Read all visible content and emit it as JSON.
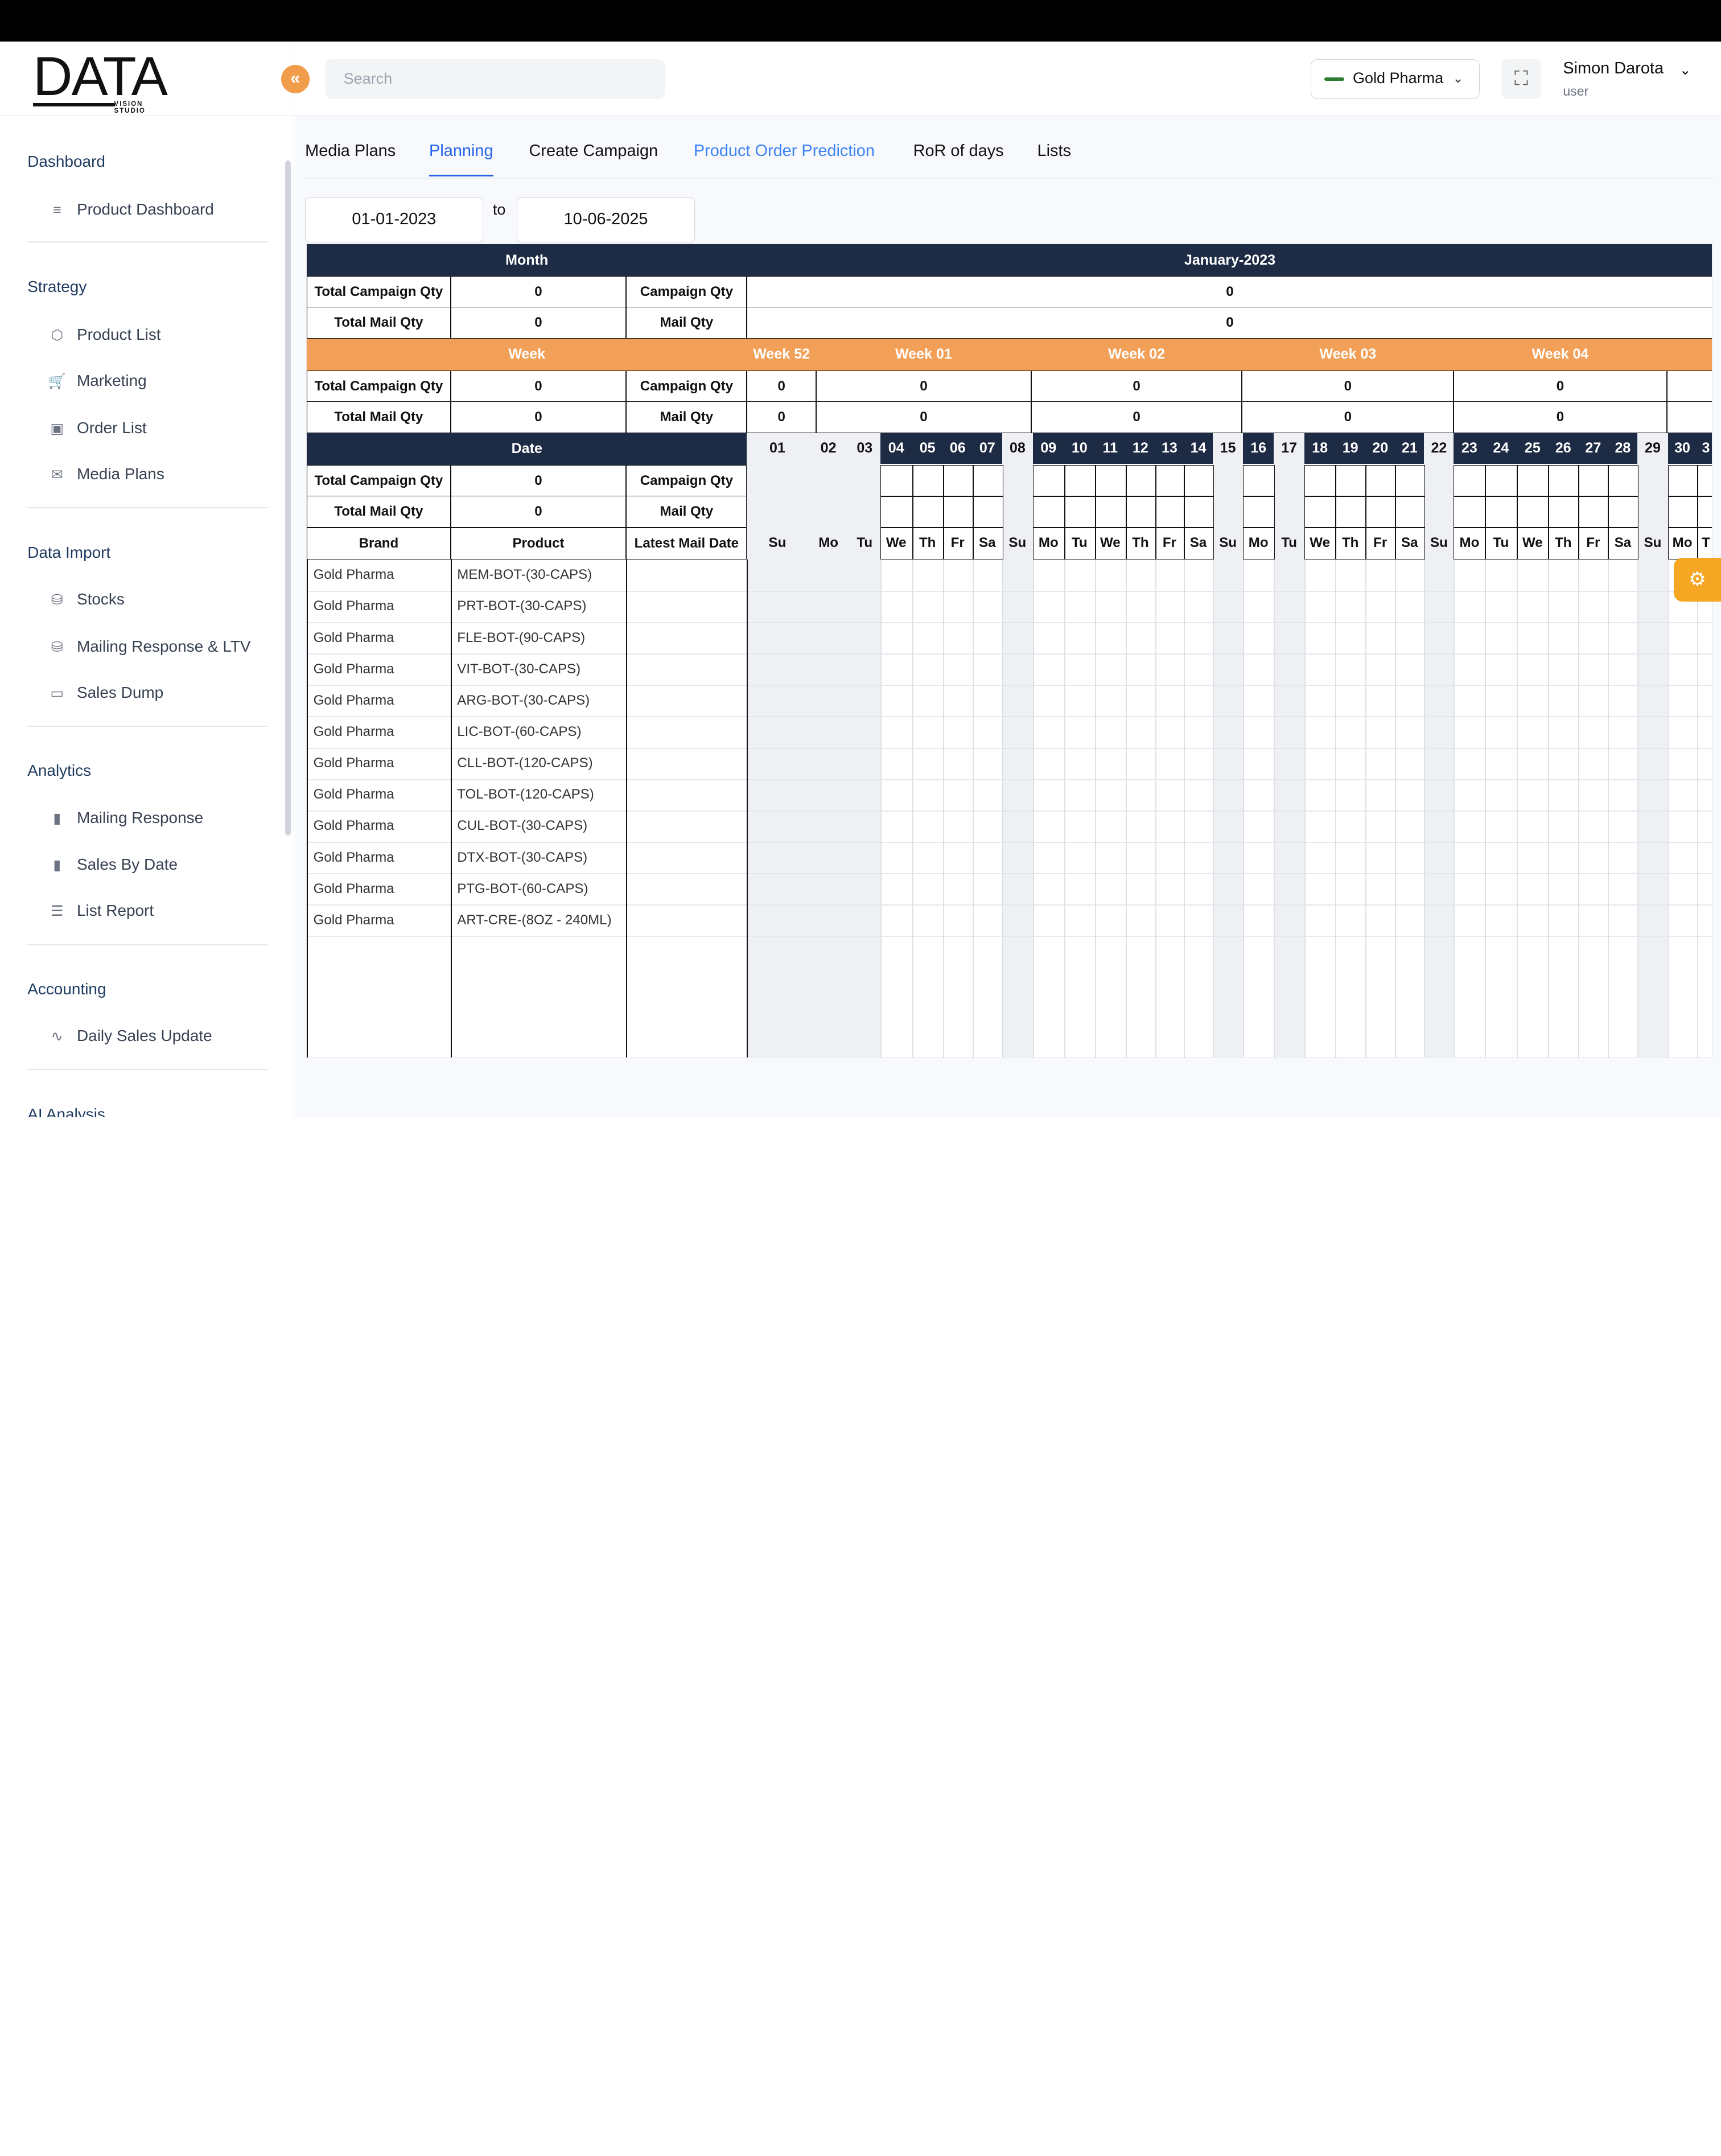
{
  "logo": {
    "text": "DATA",
    "sub": "VISION STUDIO"
  },
  "header": {
    "search_placeholder": "Search",
    "company": "Gold Pharma",
    "user_name": "Simon Darota",
    "user_role": "user"
  },
  "sidebar": {
    "sections": [
      {
        "title": "Dashboard",
        "items": [
          {
            "label": "Product Dashboard",
            "icon": "menu-icon"
          }
        ]
      },
      {
        "title": "Strategy",
        "items": [
          {
            "label": "Product List",
            "icon": "box-icon"
          },
          {
            "label": "Marketing",
            "icon": "cart-icon"
          },
          {
            "label": "Order List",
            "icon": "briefcase-icon"
          },
          {
            "label": "Media Plans",
            "icon": "mail-icon"
          }
        ]
      },
      {
        "title": "Data Import",
        "items": [
          {
            "label": "Stocks",
            "icon": "database-icon"
          },
          {
            "label": "Mailing Response & LTV",
            "icon": "database-icon"
          },
          {
            "label": "Sales Dump",
            "icon": "hard-drive-icon"
          }
        ]
      },
      {
        "title": "Analytics",
        "items": [
          {
            "label": "Mailing Response",
            "icon": "bar-chart-icon"
          },
          {
            "label": "Sales By Date",
            "icon": "bar-chart-icon"
          },
          {
            "label": "List Report",
            "icon": "list-icon"
          }
        ]
      },
      {
        "title": "Accounting",
        "items": [
          {
            "label": "Daily Sales Update",
            "icon": "activity-icon"
          }
        ]
      },
      {
        "title": "AI Analysis",
        "items": []
      }
    ]
  },
  "tabs": [
    "Media Plans",
    "Planning",
    "Create Campaign",
    "Product Order Prediction",
    "RoR of days",
    "Lists"
  ],
  "active_tab": "Planning",
  "date_range": {
    "from": "01-01-2023",
    "to_label": "to",
    "to": "10-06-2025"
  },
  "grid": {
    "month_label": "Month",
    "month_value": "January-2023",
    "week_label": "Week",
    "date_label": "Date",
    "total_campaign_qty": "Total Campaign Qty",
    "total_mail_qty": "Total Mail Qty",
    "campaign_qty": "Campaign Qty",
    "mail_qty": "Mail Qty",
    "zero": "0",
    "col_brand": "Brand",
    "col_product": "Product",
    "col_latest_mail_date": "Latest Mail Date",
    "weeks": [
      "Week 52",
      "Week 01",
      "Week 02",
      "Week 03",
      "Week 04"
    ],
    "days": [
      {
        "n": "01",
        "d": "Su"
      },
      {
        "n": "02",
        "d": "Mo"
      },
      {
        "n": "03",
        "d": "Tu"
      },
      {
        "n": "04",
        "d": "We"
      },
      {
        "n": "05",
        "d": "Th"
      },
      {
        "n": "06",
        "d": "Fr"
      },
      {
        "n": "07",
        "d": "Sa"
      },
      {
        "n": "08",
        "d": "Su"
      },
      {
        "n": "09",
        "d": "Mo"
      },
      {
        "n": "10",
        "d": "Tu"
      },
      {
        "n": "11",
        "d": "We"
      },
      {
        "n": "12",
        "d": "Th"
      },
      {
        "n": "13",
        "d": "Fr"
      },
      {
        "n": "14",
        "d": "Sa"
      },
      {
        "n": "15",
        "d": "Su"
      },
      {
        "n": "16",
        "d": "Mo"
      },
      {
        "n": "17",
        "d": "Tu"
      },
      {
        "n": "18",
        "d": "We"
      },
      {
        "n": "19",
        "d": "Th"
      },
      {
        "n": "20",
        "d": "Fr"
      },
      {
        "n": "21",
        "d": "Sa"
      },
      {
        "n": "22",
        "d": "Su"
      },
      {
        "n": "23",
        "d": "Mo"
      },
      {
        "n": "24",
        "d": "Tu"
      },
      {
        "n": "25",
        "d": "We"
      },
      {
        "n": "26",
        "d": "Th"
      },
      {
        "n": "27",
        "d": "Fr"
      },
      {
        "n": "28",
        "d": "Sa"
      },
      {
        "n": "29",
        "d": "Su"
      },
      {
        "n": "30",
        "d": "Mo"
      },
      {
        "n": "3",
        "d": "T"
      }
    ],
    "rows": [
      {
        "brand": "Gold Pharma",
        "product": "MEM-BOT-(30-CAPS)"
      },
      {
        "brand": "Gold Pharma",
        "product": "PRT-BOT-(30-CAPS)"
      },
      {
        "brand": "Gold Pharma",
        "product": "FLE-BOT-(90-CAPS)"
      },
      {
        "brand": "Gold Pharma",
        "product": "VIT-BOT-(30-CAPS)"
      },
      {
        "brand": "Gold Pharma",
        "product": "ARG-BOT-(30-CAPS)"
      },
      {
        "brand": "Gold Pharma",
        "product": "LIC-BOT-(60-CAPS)"
      },
      {
        "brand": "Gold Pharma",
        "product": "CLL-BOT-(120-CAPS)"
      },
      {
        "brand": "Gold Pharma",
        "product": "TOL-BOT-(120-CAPS)"
      },
      {
        "brand": "Gold Pharma",
        "product": "CUL-BOT-(30-CAPS)"
      },
      {
        "brand": "Gold Pharma",
        "product": "DTX-BOT-(30-CAPS)"
      },
      {
        "brand": "Gold Pharma",
        "product": "PTG-BOT-(60-CAPS)"
      },
      {
        "brand": "Gold Pharma",
        "product": "ART-CRE-(8OZ - 240ML)"
      }
    ]
  },
  "colors": {
    "navy": "#1d2b44",
    "orange": "#f2a057",
    "accent": "#2563eb"
  }
}
